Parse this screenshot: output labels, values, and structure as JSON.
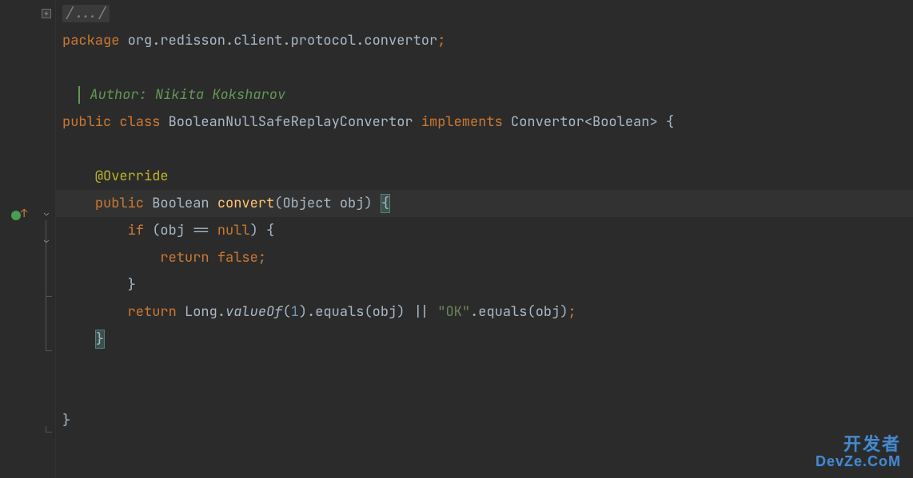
{
  "code": {
    "folded_comment": "/.../",
    "package_kw": "package",
    "package_name": " org.redisson.client.protocol.convertor",
    "semi": ";",
    "doc_author": "Author: Nikita Koksharov",
    "public_kw": "public",
    "class_kw": "class",
    "class_name": "BooleanNullSafeReplayConvertor",
    "implements_kw": "implements",
    "interface_name": "Convertor",
    "type_param": "Boolean",
    "brace_open": " {",
    "override_annotation": "@Override",
    "return_type": "Boolean",
    "method_name": "convert",
    "param_type": "Object",
    "param_name": "obj",
    "method_brace": " {",
    "if_kw": "if",
    "null_kw": "null",
    "eq": " == ",
    "paren_open": "(",
    "paren_close": ")",
    "if_brace": " {",
    "return_kw": "return",
    "false_kw": "false",
    "close_brace": "}",
    "long_class": "Long",
    "valueof": "valueOf",
    "one": "1",
    "equals": "equals",
    "obj": "obj",
    "or_op": " || ",
    "ok_str": "\"OK\"",
    "dot": "."
  },
  "watermark": {
    "top": "开发者",
    "bottom": "DevZe.CoM"
  }
}
